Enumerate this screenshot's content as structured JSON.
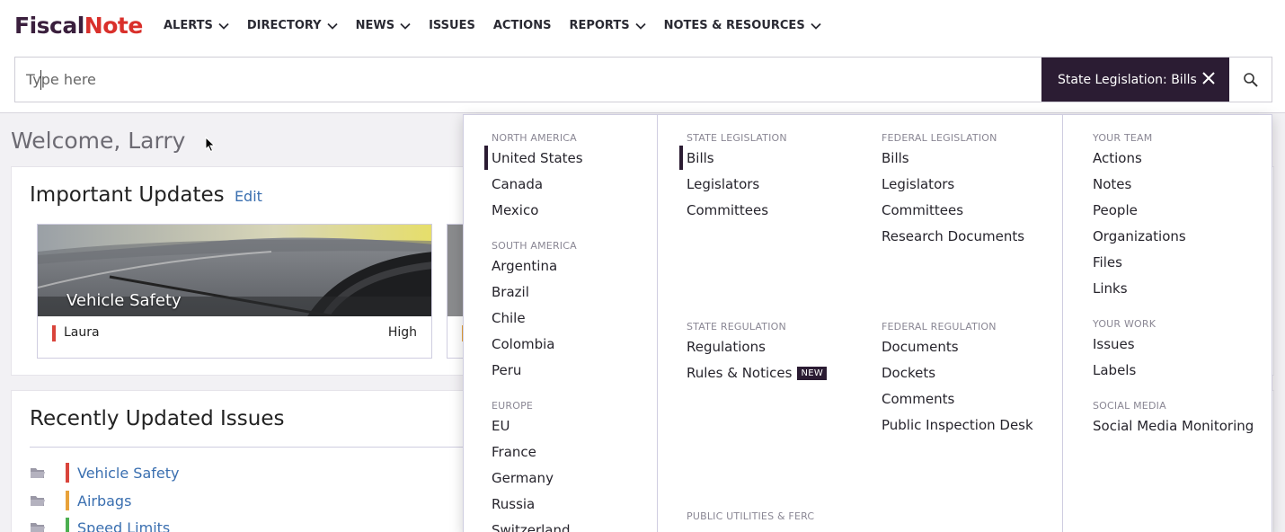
{
  "logo": {
    "part1": "Fiscal",
    "part2": "Note"
  },
  "nav": [
    {
      "label": "ALERTS",
      "dropdown": true
    },
    {
      "label": "DIRECTORY",
      "dropdown": true
    },
    {
      "label": "NEWS",
      "dropdown": true
    },
    {
      "label": "ISSUES",
      "dropdown": false
    },
    {
      "label": "ACTIONS",
      "dropdown": false
    },
    {
      "label": "REPORTS",
      "dropdown": true
    },
    {
      "label": "NOTES & RESOURCES",
      "dropdown": true
    }
  ],
  "search": {
    "placeholder": "Type here",
    "scope_label": "State Legislation:",
    "scope_value": "Bills"
  },
  "welcome": "Welcome, Larry",
  "updates": {
    "title": "Important Updates",
    "edit": "Edit",
    "tiles": [
      {
        "name": "Vehicle Safety",
        "owner": "Laura",
        "owner_color": "#d9443b",
        "priority": "High"
      }
    ]
  },
  "issues": {
    "title": "Recently Updated Issues",
    "items": [
      {
        "label": "Vehicle Safety",
        "color": "#d9443b"
      },
      {
        "label": "Airbags",
        "color": "#e8a23a"
      },
      {
        "label": "Speed Limits",
        "color": "#4caf50"
      }
    ]
  },
  "menu": {
    "north_america": {
      "heading": "NORTH AMERICA",
      "items": [
        "United States",
        "Canada",
        "Mexico"
      ]
    },
    "south_america": {
      "heading": "SOUTH AMERICA",
      "items": [
        "Argentina",
        "Brazil",
        "Chile",
        "Colombia",
        "Peru"
      ]
    },
    "europe": {
      "heading": "EUROPE",
      "items": [
        "EU",
        "France",
        "Germany",
        "Russia",
        "Switzerland"
      ]
    },
    "state_legislation": {
      "heading": "STATE LEGISLATION",
      "items": [
        "Bills",
        "Legislators",
        "Committees"
      ]
    },
    "federal_legislation": {
      "heading": "FEDERAL LEGISLATION",
      "items": [
        "Bills",
        "Legislators",
        "Committees",
        "Research Documents"
      ]
    },
    "state_regulation": {
      "heading": "STATE REGULATION",
      "items": [
        "Regulations",
        "Rules & Notices"
      ],
      "badge": "NEW"
    },
    "federal_regulation": {
      "heading": "FEDERAL REGULATION",
      "items": [
        "Documents",
        "Dockets",
        "Comments",
        "Public Inspection Desk"
      ]
    },
    "public_utilities": {
      "heading": "PUBLIC UTILITIES & FERC"
    },
    "your_team": {
      "heading": "YOUR TEAM",
      "items": [
        "Actions",
        "Notes",
        "People",
        "Organizations",
        "Files",
        "Links"
      ]
    },
    "your_work": {
      "heading": "YOUR WORK",
      "items": [
        "Issues",
        "Labels"
      ]
    },
    "social_media": {
      "heading": "SOCIAL MEDIA",
      "items": [
        "Social Media Monitoring"
      ]
    }
  },
  "colors": {
    "brand_dark": "#2b1c33",
    "brand_red": "#d9302b",
    "link": "#3a6fb0"
  }
}
